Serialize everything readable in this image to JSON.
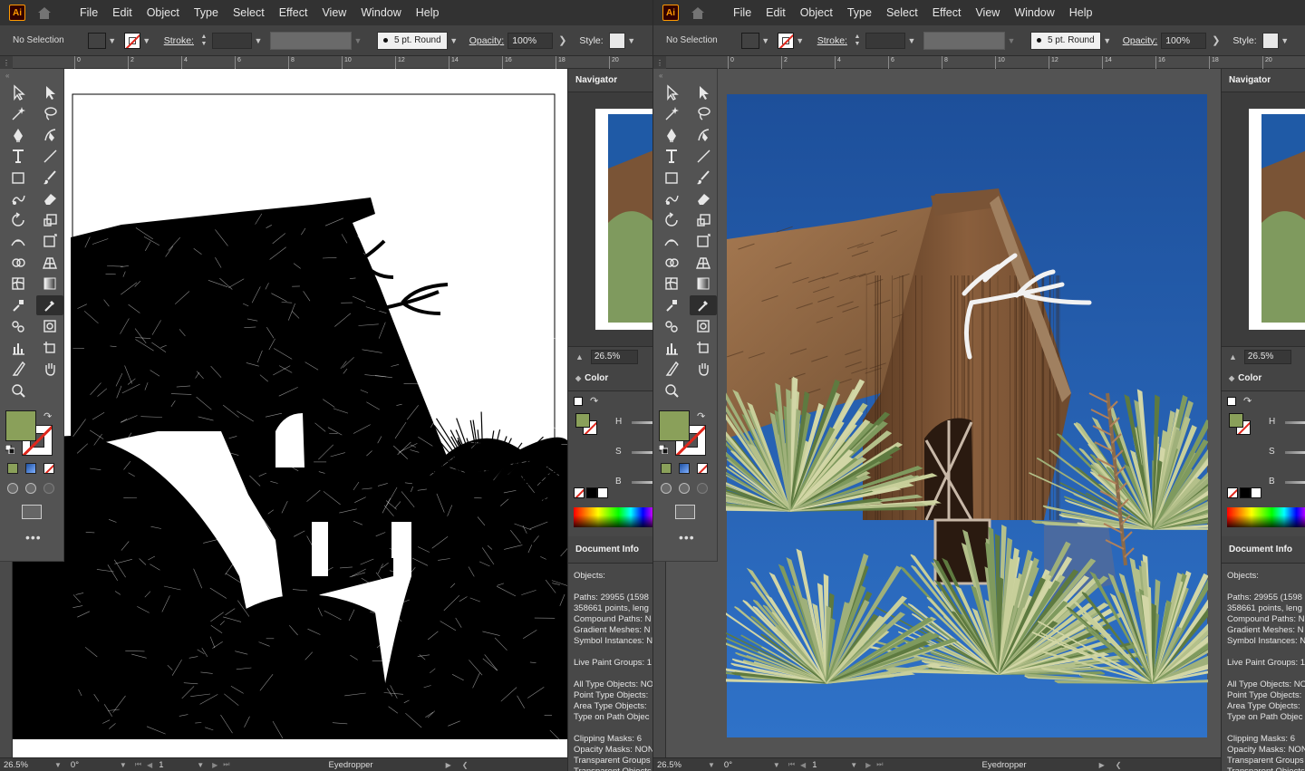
{
  "windows": [
    {
      "id": "left",
      "view_mode": "outline",
      "app_logo": "Ai",
      "menu": [
        "File",
        "Edit",
        "Object",
        "Type",
        "Select",
        "Effect",
        "View",
        "Window",
        "Help"
      ],
      "control_bar": {
        "selection_status": "No Selection",
        "stroke_label": "Stroke:",
        "brush_label": "5 pt. Round",
        "opacity_label": "Opacity:",
        "opacity_value": "100%",
        "style_label": "Style:"
      },
      "ruler_ticks": [
        "0",
        "2",
        "4",
        "6",
        "8",
        "10",
        "12",
        "14",
        "16",
        "18",
        "20"
      ],
      "navigator": {
        "title": "Navigator",
        "zoom": "26.5%"
      },
      "color_panel": {
        "title": "Color",
        "channels": [
          "H",
          "S",
          "B"
        ]
      },
      "document_info": {
        "title": "Document Info",
        "lines": [
          "Objects:",
          "",
          "Paths: 29955 (1598",
          "358661 points, leng",
          "Compound Paths: N",
          "Gradient Meshes: N",
          "Symbol Instances: N",
          "",
          "Live Paint Groups: 1",
          "",
          "All Type Objects: NO",
          "Point Type Objects:",
          "Area Type Objects:",
          "Type on Path Objec",
          "",
          "Clipping Masks: 6",
          "Opacity Masks: NON",
          "Transparent Groups",
          "Transparent Objects"
        ]
      },
      "status_bar": {
        "zoom": "26.5%",
        "rotation": "0°",
        "artboard": "1",
        "tool": "Eyedropper"
      }
    },
    {
      "id": "right",
      "view_mode": "preview",
      "app_logo": "Ai",
      "menu": [
        "File",
        "Edit",
        "Object",
        "Type",
        "Select",
        "Effect",
        "View",
        "Window",
        "Help"
      ],
      "control_bar": {
        "selection_status": "No Selection",
        "stroke_label": "Stroke:",
        "brush_label": "5 pt. Round",
        "opacity_label": "Opacity:",
        "opacity_value": "100%",
        "style_label": "Style:"
      },
      "ruler_ticks": [
        "0",
        "2",
        "4",
        "6",
        "8",
        "10",
        "12",
        "14",
        "16",
        "18",
        "20"
      ],
      "navigator": {
        "title": "Navigator",
        "zoom": "26.5%"
      },
      "color_panel": {
        "title": "Color",
        "channels": [
          "H",
          "S",
          "B"
        ]
      },
      "document_info": {
        "title": "Document Info",
        "lines": [
          "Objects:",
          "",
          "Paths: 29955 (1598",
          "358661 points, leng",
          "Compound Paths: N",
          "Gradient Meshes: N",
          "Symbol Instances: N",
          "",
          "Live Paint Groups: 1",
          "",
          "All Type Objects: NO",
          "Point Type Objects:",
          "Area Type Objects:",
          "Type on Path Objec",
          "",
          "Clipping Masks: 6",
          "Opacity Masks: NON",
          "Transparent Groups",
          "Transparent Objects"
        ]
      },
      "status_bar": {
        "zoom": "26.5%",
        "rotation": "0°",
        "artboard": "1",
        "tool": "Eyedropper"
      }
    }
  ],
  "colors": {
    "fill": "#8aa05a",
    "stroke_none_slash": "#e0271c",
    "ui_background": "#535353",
    "menubar": "#323232",
    "sky": "#1f5aa6"
  },
  "tool_icons": [
    [
      "selection-icon",
      "direct-selection-icon"
    ],
    [
      "magic-wand-icon",
      "lasso-icon"
    ],
    [
      "pen-icon",
      "curvature-icon"
    ],
    [
      "type-icon",
      "line-segment-icon"
    ],
    [
      "rectangle-icon",
      "paintbrush-icon"
    ],
    [
      "shaper-icon",
      "eraser-icon"
    ],
    [
      "rotate-icon",
      "scale-icon"
    ],
    [
      "width-icon",
      "free-transform-icon"
    ],
    [
      "shape-builder-icon",
      "perspective-grid-icon"
    ],
    [
      "mesh-icon",
      "gradient-icon"
    ],
    [
      "eyedropper-blend-icon",
      "eyedropper-icon"
    ],
    [
      "symbol-sprayer-icon",
      "column-graph-icon-2"
    ],
    [
      "column-graph-icon",
      "artboard-icon"
    ],
    [
      "slice-icon",
      "hand-icon"
    ],
    [
      "zoom-icon"
    ]
  ]
}
